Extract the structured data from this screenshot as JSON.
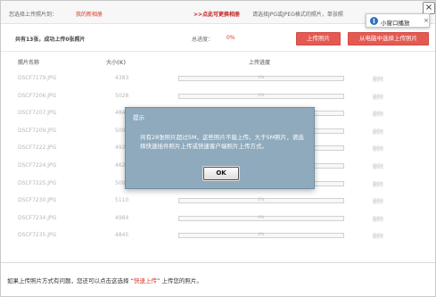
{
  "topbar": {
    "upload_to_label": "您选择上传照片到：",
    "album_name": "我的新相册",
    "change_link": ">>点此可更换相册",
    "hint": "请选择JPG或JPEG格式的照片，单张照",
    "close_glyph": "×"
  },
  "mini_popup": {
    "label": "小窗口播放",
    "close_glyph": "×"
  },
  "status": {
    "summary": "共有13张，成功上传0张照片",
    "progress_label": "总进度：",
    "progress_value": "0%",
    "upload_button": "上传照片",
    "select_button": "从电脑中选择上传照片"
  },
  "table": {
    "headers": {
      "name": "照片名称",
      "size": "大小(K)",
      "progress": "上传进度"
    },
    "rows": [
      {
        "name": "DSCF7179.JPG",
        "size": "4383",
        "progress": "0%",
        "delete": "删除"
      },
      {
        "name": "DSCF7206.JPG",
        "size": "5028",
        "progress": "0%",
        "delete": "删除"
      },
      {
        "name": "DSCF7207.JPG",
        "size": "484",
        "progress": "0%",
        "delete": "删除"
      },
      {
        "name": "DSCF7209.JPG",
        "size": "500",
        "progress": "0%",
        "delete": "删除"
      },
      {
        "name": "DSCF7222.JPG",
        "size": "492",
        "progress": "0%",
        "delete": "删除"
      },
      {
        "name": "DSCF7224.JPG",
        "size": "462",
        "progress": "0%",
        "delete": "删除"
      },
      {
        "name": "DSCF7225.JPG",
        "size": "5006",
        "progress": "0%",
        "delete": "删除"
      },
      {
        "name": "DSCF7230.JPG",
        "size": "5110",
        "progress": "0%",
        "delete": "删除"
      },
      {
        "name": "DSCF7234.JPG",
        "size": "4984",
        "progress": "0%",
        "delete": "删除"
      },
      {
        "name": "DSCF7235.JPG",
        "size": "4845",
        "progress": "0%",
        "delete": "删除"
      }
    ]
  },
  "dialog": {
    "title": "提示",
    "message": "共有28张照片超过5M，这些照片不能上传。大于5M照片，请选择快速插件照片上传或快速客户端照片上传方式。",
    "ok_button": "OK"
  },
  "footer": {
    "text_before": "如果上传照片方式有问题，您还可以点击这选择 “",
    "link": "快速上传",
    "text_after": "” 上传您的照片。"
  },
  "colors": {
    "accent_red": "#d63a2a",
    "button_red": "#e45a52",
    "dialog_blue": "#8faabd"
  }
}
